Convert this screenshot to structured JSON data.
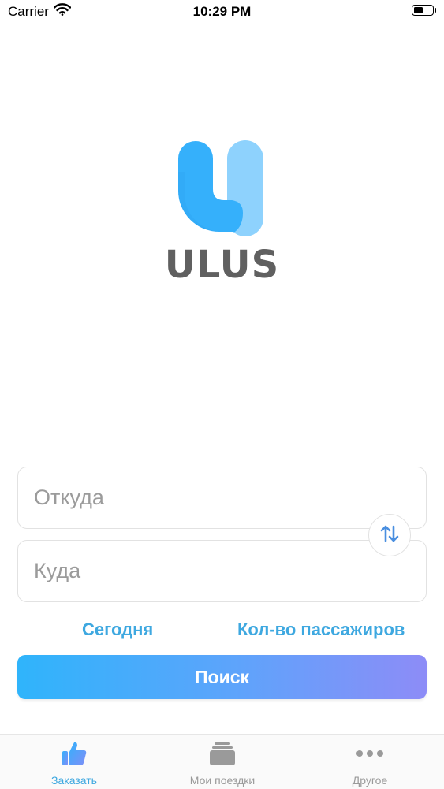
{
  "status_bar": {
    "carrier": "Carrier",
    "time": "10:29 PM",
    "battery_level": 0.5
  },
  "logo": {
    "text": "ULUS",
    "colors": {
      "primary": "#35b0fb",
      "secondary": "#8ed2fd",
      "text": "#606060"
    }
  },
  "form": {
    "from_placeholder": "Откуда",
    "to_placeholder": "Куда",
    "swap_icon": "swap-vertical-arrows",
    "date_label": "Сегодня",
    "passengers_label": "Кол-во пассажиров",
    "search_label": "Поиск"
  },
  "tabs": [
    {
      "label": "Заказать",
      "icon": "thumbs-up-icon",
      "active": true
    },
    {
      "label": "Мои поездки",
      "icon": "trips-stack-icon",
      "active": false
    },
    {
      "label": "Другое",
      "icon": "more-dots-icon",
      "active": false
    }
  ],
  "colors": {
    "accent": "#3ea8e0",
    "gradient_start": "#2fb4fb",
    "gradient_end": "#8d8cf7",
    "inactive": "#9a9a9a"
  }
}
